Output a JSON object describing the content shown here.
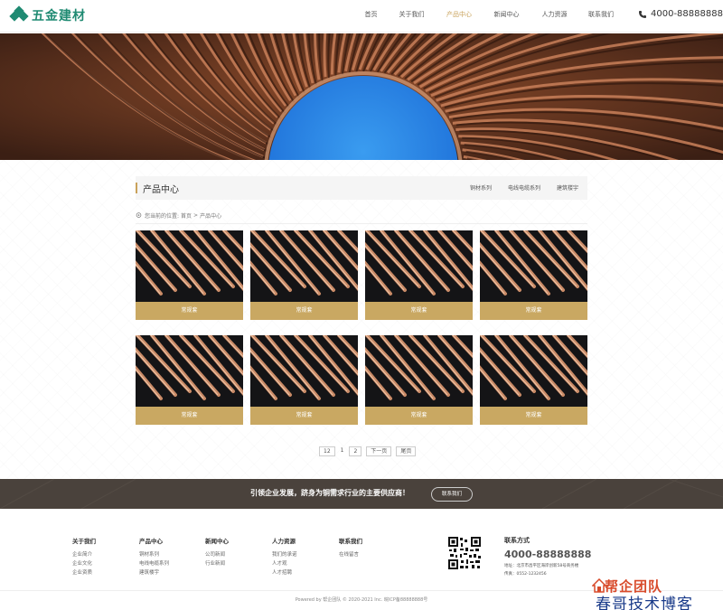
{
  "header": {
    "logo": "五金建材",
    "nav": [
      "首页",
      "关于我们",
      "产品中心",
      "新闻中心",
      "人力资源",
      "联系我们"
    ],
    "active_nav": "产品中心",
    "phone": "4000-88888888"
  },
  "section": {
    "title": "产品中心",
    "tabs": [
      "铜材系列",
      "电线电缆系列",
      "建筑楼宇"
    ]
  },
  "breadcrumb": {
    "prefix": "您当前的位置:",
    "home": "首页",
    "sep": ">",
    "current": "产品中心"
  },
  "products": [
    "常规套",
    "常规套",
    "常规套",
    "常规套",
    "常规套",
    "常规套",
    "常规套",
    "常规套"
  ],
  "pagination": {
    "total": "12",
    "pages": [
      "1",
      "2"
    ],
    "next": "下一页",
    "last": "尾页"
  },
  "slogan": {
    "text": "引领企业发展，跻身为铜需求行业的主要供应商！",
    "button": "联系我们"
  },
  "footer": {
    "columns": [
      {
        "title": "关于我们",
        "links": [
          "企业简介",
          "企业文化",
          "企业资质"
        ]
      },
      {
        "title": "产品中心",
        "links": [
          "铜材系列",
          "电线电缆系列",
          "建筑楼宇"
        ]
      },
      {
        "title": "新闻中心",
        "links": [
          "公司新闻",
          "行业新闻"
        ]
      },
      {
        "title": "人力资源",
        "links": [
          "我们的承诺",
          "人才观",
          "人才招聘"
        ]
      },
      {
        "title": "联系我们",
        "links": [
          "在线留言"
        ]
      }
    ],
    "contact": {
      "title": "联系方式",
      "phone": "4000-88888888",
      "address": "地址：北京市昌平区海岸创新58号商务楼",
      "fax": "传真：0552-1232456"
    },
    "copyright": "Powered by  帮企团队  © 2020-2021 Inc. 皖ICP备88888888号",
    "watermark_brand": "帮企团队",
    "watermark_text": "春哥技术博客"
  },
  "colors": {
    "brand": "#1f8a72",
    "accent": "#c9a25a",
    "card_label": "#c9a862",
    "slogan_bg": "#4a423c"
  }
}
